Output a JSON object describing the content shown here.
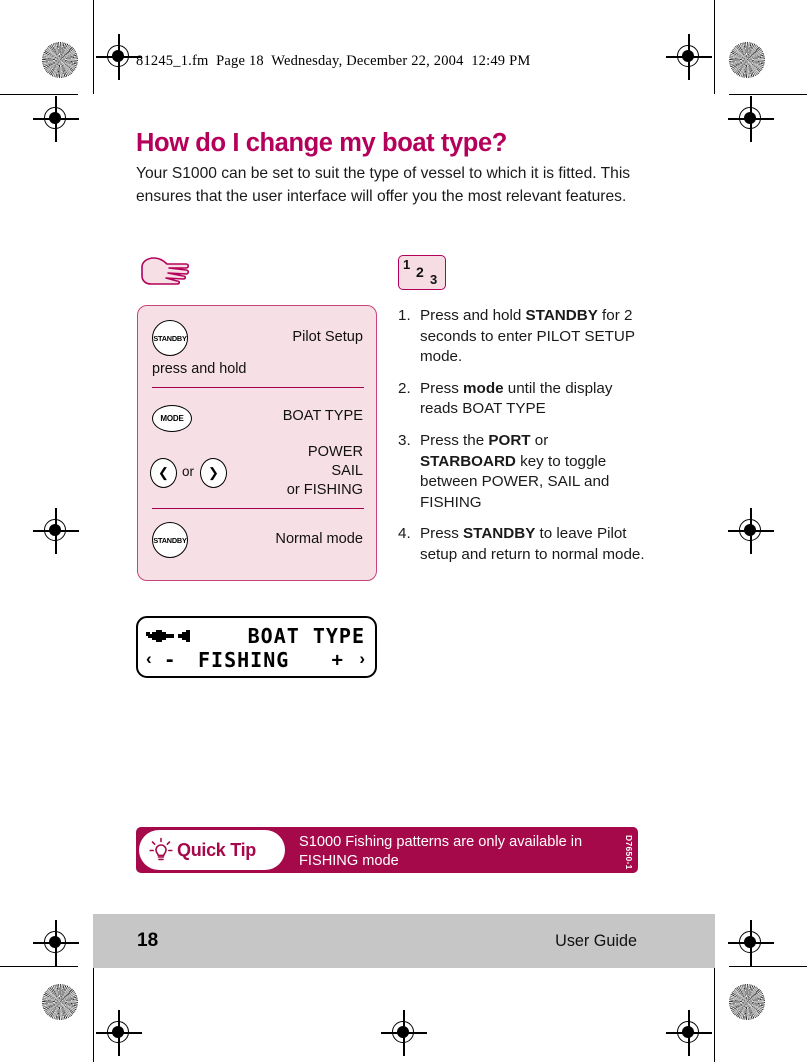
{
  "document_header": {
    "text": "81245_1.fm  Page 18  Wednesday, December 22, 2004  12:49 PM"
  },
  "page": {
    "title": "How do I change my boat type?",
    "intro": "Your S1000 can be set to suit the type of vessel to which it is fitted. This ensures that the user interface will offer you the most relevant features."
  },
  "badge_123": {
    "n1": "1",
    "n2": "2",
    "n3": "3"
  },
  "key_panel": {
    "standby_top_label": "STANDBY",
    "standby_top_right": "Pilot Setup",
    "press_and_hold": "press and hold",
    "mode_label": "MODE",
    "mode_right": "BOAT TYPE",
    "arrow_left": "❮",
    "arrow_right": "❯",
    "or": "or",
    "options_line1": "POWER",
    "options_line2": "SAIL",
    "options_line3": "or FISHING",
    "standby_bottom_label": "STANDBY",
    "standby_bottom_right": "Normal mode"
  },
  "steps": [
    {
      "num": "1.",
      "parts": [
        {
          "t": "Press and hold ",
          "b": false
        },
        {
          "t": "STANDBY",
          "b": true
        },
        {
          "t": " for 2 seconds to enter PILOT SETUP mode.",
          "b": false
        }
      ]
    },
    {
      "num": "2.",
      "parts": [
        {
          "t": "Press ",
          "b": false
        },
        {
          "t": "mode",
          "b": true
        },
        {
          "t": " until the display reads BOAT TYPE",
          "b": false
        }
      ]
    },
    {
      "num": "3.",
      "parts": [
        {
          "t": "Press the ",
          "b": false
        },
        {
          "t": "PORT",
          "b": true
        },
        {
          "t": " or ",
          "b": false
        },
        {
          "t": "STARBOARD",
          "b": true
        },
        {
          "t": " key to toggle between POWER, SAIL and FISHING",
          "b": false
        }
      ]
    },
    {
      "num": "4.",
      "parts": [
        {
          "t": "Press ",
          "b": false
        },
        {
          "t": "STANDBY",
          "b": true
        },
        {
          "t": " to leave Pilot setup and return to normal mode.",
          "b": false
        }
      ]
    }
  ],
  "lcd": {
    "icon": "wrench-icon",
    "title": "BOAT TYPE",
    "left_chevron": "‹",
    "minus": "-",
    "value": "FISHING",
    "plus": "+",
    "right_chevron": "›"
  },
  "quick_tip": {
    "pill_label": "Quick Tip",
    "icon": "lightbulb-icon",
    "text": "S1000 Fishing patterns are only available in FISHING mode",
    "code": "D7650-1"
  },
  "footer": {
    "page_number": "18",
    "right_label": "User Guide"
  },
  "colors": {
    "brand_crimson": "#b4005a",
    "tip_bar": "#a6094a",
    "panel_pink": "#f6dfe5",
    "panel_border": "#c9447b",
    "divider": "#a5004e",
    "footer_grey": "#c6c6c6"
  }
}
